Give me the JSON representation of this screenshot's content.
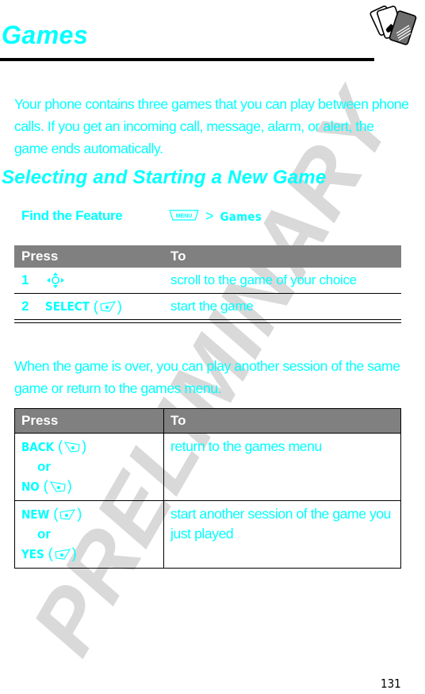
{
  "watermark": "PRELIMINARY",
  "page": {
    "title": "Games",
    "title_icon": "playing-cards-icon",
    "intro": "Your phone contains three games that you can play between phone calls. If you get an incoming call, message, alarm, or alert, the game ends automatically.",
    "section_heading": "Selecting and Starting a New Game",
    "find_feature": {
      "label": "Find the Feature",
      "menu_key": "MENU",
      "separator": ">",
      "path": "Games"
    },
    "table1": {
      "headers": [
        "Press",
        "To"
      ],
      "rows": [
        {
          "num": "1",
          "key_icon": "nav-scroll-icon",
          "key_label": "",
          "to": "scroll to the game of your choice"
        },
        {
          "num": "2",
          "key_label": "SELECT",
          "key_icon": "right-softkey-icon",
          "to": "start the game"
        }
      ]
    },
    "para2": "When the game is over, you can play another session of the same game or return to the games menu.",
    "table2": {
      "headers": [
        "Press",
        "To"
      ],
      "rows": [
        {
          "keys": [
            {
              "label": "BACK",
              "icon": "left-softkey-icon"
            },
            {
              "label": "NO",
              "icon": "left-softkey-icon"
            }
          ],
          "or": "or",
          "to": "return to the games menu"
        },
        {
          "keys": [
            {
              "label": "NEW",
              "icon": "right-softkey-icon"
            },
            {
              "label": "YES",
              "icon": "right-softkey-icon"
            }
          ],
          "or": "or",
          "to": "start another session of the game you just played"
        }
      ]
    },
    "page_number": "131"
  },
  "colors": {
    "accent": "#00ffff",
    "header_bg": "#808080",
    "watermark": "#d9d9d9",
    "rule": "#000000"
  }
}
